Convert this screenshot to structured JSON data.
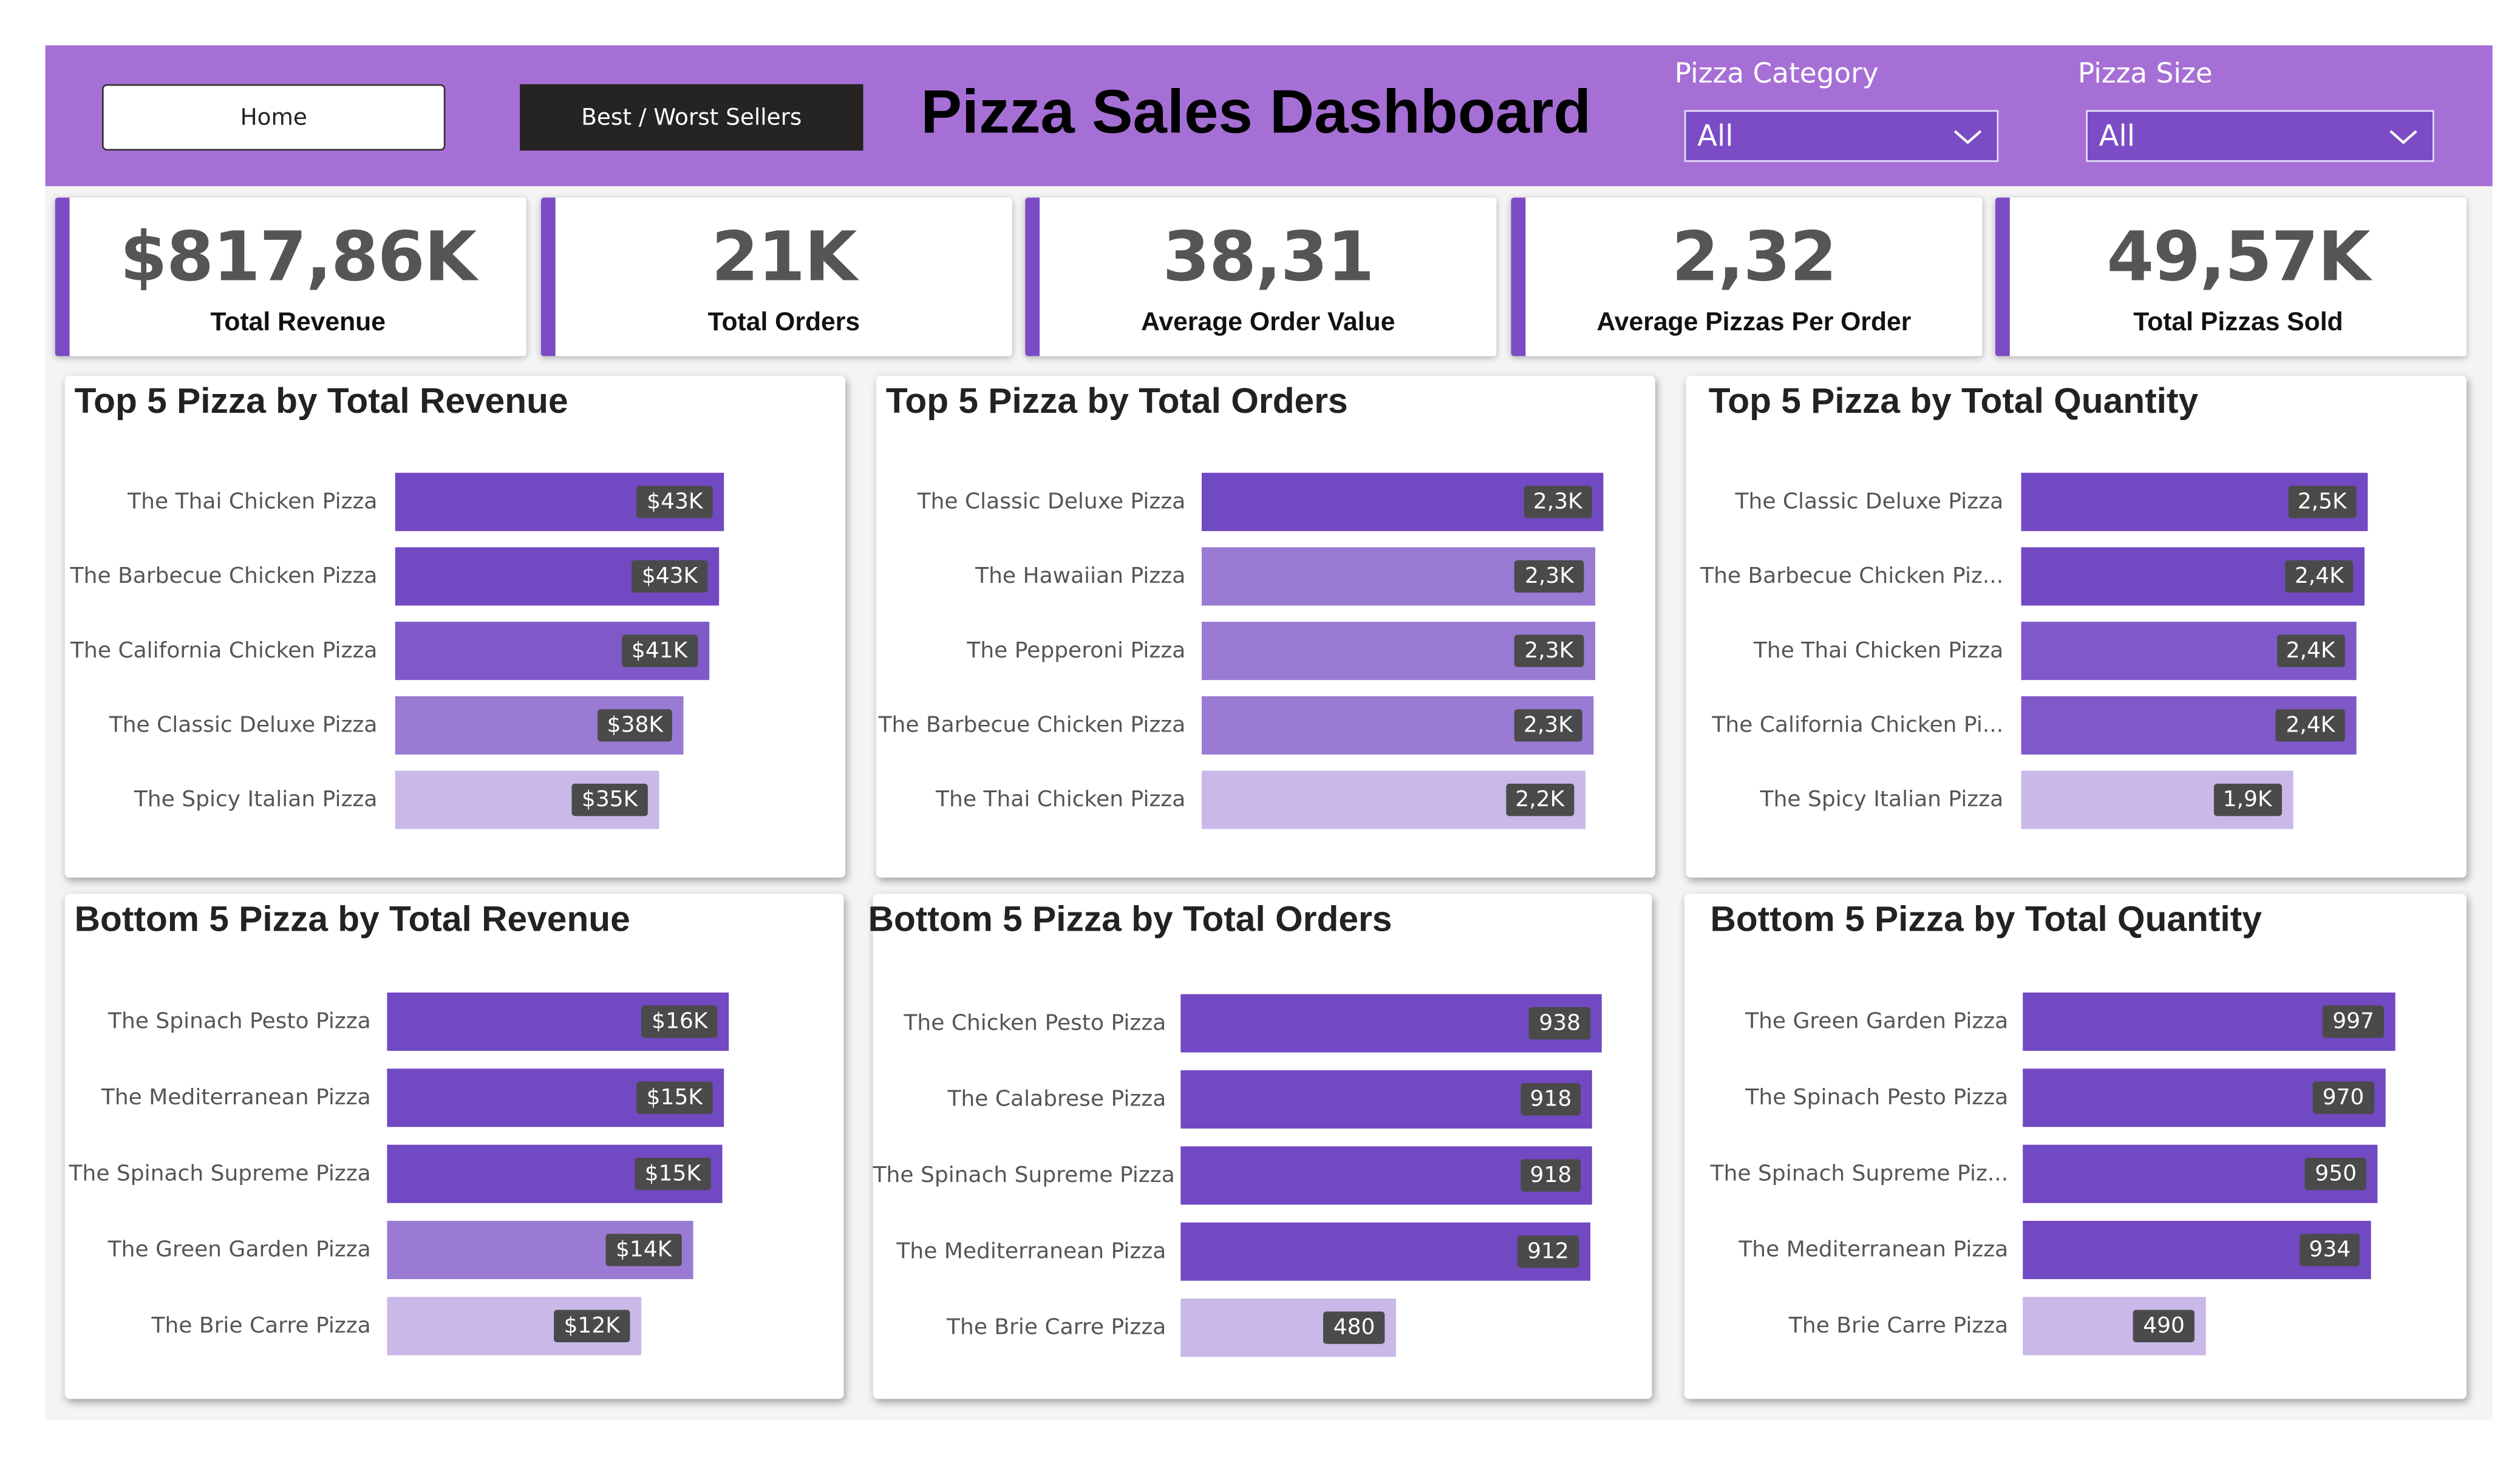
{
  "header": {
    "home_button": "Home",
    "best_worst_button": "Best / Worst Sellers",
    "title": "Pizza Sales Dashboard",
    "category_label": "Pizza Category",
    "category_value": "All",
    "size_label": "Pizza Size",
    "size_value": "All"
  },
  "kpis": [
    {
      "value": "$817,86K",
      "label": "Total Revenue"
    },
    {
      "value": "21K",
      "label": "Total Orders"
    },
    {
      "value": "38,31",
      "label": "Average Order Value"
    },
    {
      "value": "2,32",
      "label": "Average Pizzas Per Order"
    },
    {
      "value": "49,57K",
      "label": "Total Pizzas Sold"
    }
  ],
  "colors": {
    "header": "#a66fd6",
    "accent": "#7b4cc6",
    "bar_shades": [
      "#7149c2",
      "#8059c9",
      "#9a7ad3",
      "#b09ad9",
      "#c9b8e8"
    ]
  },
  "chart_data": [
    {
      "type": "bar",
      "title": "Top 5 Pizza by Total Revenue",
      "categories": [
        "The Thai Chicken Pizza",
        "The Barbecue Chicken Pizza",
        "The California Chicken Pizza",
        "The Classic Deluxe Pizza",
        "The Spicy Italian Pizza"
      ],
      "values": [
        43434,
        42768,
        41410,
        38180,
        34831
      ],
      "value_labels": [
        "$43K",
        "$43K",
        "$41K",
        "$38K",
        "$35K"
      ]
    },
    {
      "type": "bar",
      "title": "Top 5 Pizza by Total Orders",
      "categories": [
        "The Classic Deluxe Pizza",
        "The Hawaiian Pizza",
        "The Pepperoni Pizza",
        "The Barbecue Chicken Pizza",
        "The Thai Chicken Pizza"
      ],
      "values": [
        2329,
        2280,
        2278,
        2273,
        2225
      ],
      "value_labels": [
        "2,3K",
        "2,3K",
        "2,3K",
        "2,3K",
        "2,2K"
      ]
    },
    {
      "type": "bar",
      "title": "Top 5 Pizza by Total Quantity",
      "categories": [
        "The Classic Deluxe Pizza",
        "The Barbecue Chicken Piz...",
        "The Thai Chicken Pizza",
        "The California Chicken Pi...",
        "The Spicy Italian Pizza"
      ],
      "values": [
        2453,
        2432,
        2371,
        2370,
        1924
      ],
      "value_labels": [
        "2,5K",
        "2,4K",
        "2,4K",
        "2,4K",
        "1,9K"
      ]
    },
    {
      "type": "bar",
      "title": "Bottom 5 Pizza by Total Revenue",
      "categories": [
        "The Spinach Pesto Pizza",
        "The Mediterranean Pizza",
        "The Spinach Supreme Pizza",
        "The Green Garden Pizza",
        "The Brie Carre Pizza"
      ],
      "values": [
        15596,
        15360,
        15277,
        13956,
        11588
      ],
      "value_labels": [
        "$16K",
        "$15K",
        "$15K",
        "$14K",
        "$12K"
      ]
    },
    {
      "type": "bar",
      "title": "Bottom 5 Pizza by Total Orders",
      "categories": [
        "The Chicken Pesto Pizza",
        "The Calabrese Pizza",
        "The Spinach Supreme Pizza",
        "The Mediterranean Pizza",
        "The Brie Carre Pizza"
      ],
      "values": [
        938,
        918,
        918,
        912,
        480
      ],
      "value_labels": [
        "938",
        "918",
        "918",
        "912",
        "480"
      ]
    },
    {
      "type": "bar",
      "title": "Bottom 5 Pizza by Total Quantity",
      "categories": [
        "The Green Garden Pizza",
        "The Spinach Pesto Pizza",
        "The Spinach Supreme Piz...",
        "The Mediterranean Pizza",
        "The Brie Carre Pizza"
      ],
      "values": [
        997,
        970,
        950,
        934,
        490
      ],
      "value_labels": [
        "997",
        "970",
        "950",
        "934",
        "490"
      ]
    }
  ]
}
